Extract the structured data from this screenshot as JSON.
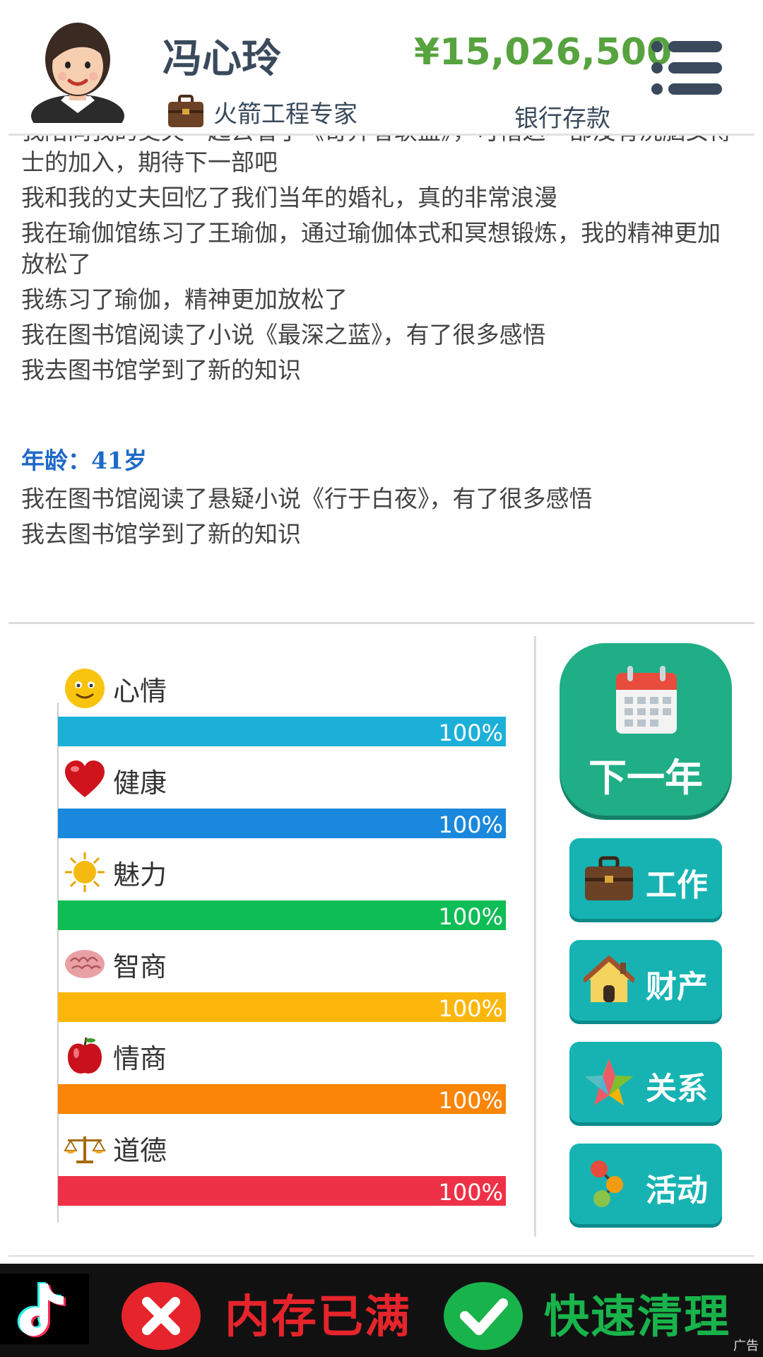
{
  "header": {
    "name": "冯心玲",
    "job_title": "火箭工程专家",
    "money": "¥15,026,500",
    "money_label": "银行存款"
  },
  "log": {
    "entries_before": [
      "我陪同我的丈夫一起去看了《奇异者联盟》，可惜这一部没有洗脑女博士的加入，期待下一部吧",
      "我和我的丈夫回忆了我们当年的婚礼，真的非常浪漫",
      "我在瑜伽馆练习了王瑜伽，通过瑜伽体式和冥想锻炼，我的精神更加放松了",
      "我练习了瑜伽，精神更加放松了",
      "我在图书馆阅读了小说《最深之蓝》，有了很多感悟",
      "我去图书馆学到了新的知识"
    ],
    "age_label": "年龄：41岁",
    "entries_after": [
      "我在图书馆阅读了悬疑小说《行于白夜》，有了很多感悟",
      "我去图书馆学到了新的知识"
    ]
  },
  "stats": [
    {
      "label": "心情",
      "value": 100,
      "text": "100%",
      "color": "#1cb0d8",
      "icon": "smiley-icon"
    },
    {
      "label": "健康",
      "value": 100,
      "text": "100%",
      "color": "#1a88dc",
      "icon": "heart-icon"
    },
    {
      "label": "魅力",
      "value": 100,
      "text": "100%",
      "color": "#0ebd55",
      "icon": "sun-icon"
    },
    {
      "label": "智商",
      "value": 100,
      "text": "100%",
      "color": "#fdb70c",
      "icon": "brain-icon"
    },
    {
      "label": "情商",
      "value": 100,
      "text": "100%",
      "color": "#fb8507",
      "icon": "apple-icon"
    },
    {
      "label": "道德",
      "value": 100,
      "text": "100%",
      "color": "#ee3146",
      "icon": "scales-icon"
    }
  ],
  "buttons": {
    "next_year": "下一年",
    "work": "工作",
    "property": "财产",
    "relations": "关系",
    "activities": "活动"
  },
  "ad": {
    "text1": "内存已满",
    "text2": "快速清理",
    "tag": "广告"
  }
}
